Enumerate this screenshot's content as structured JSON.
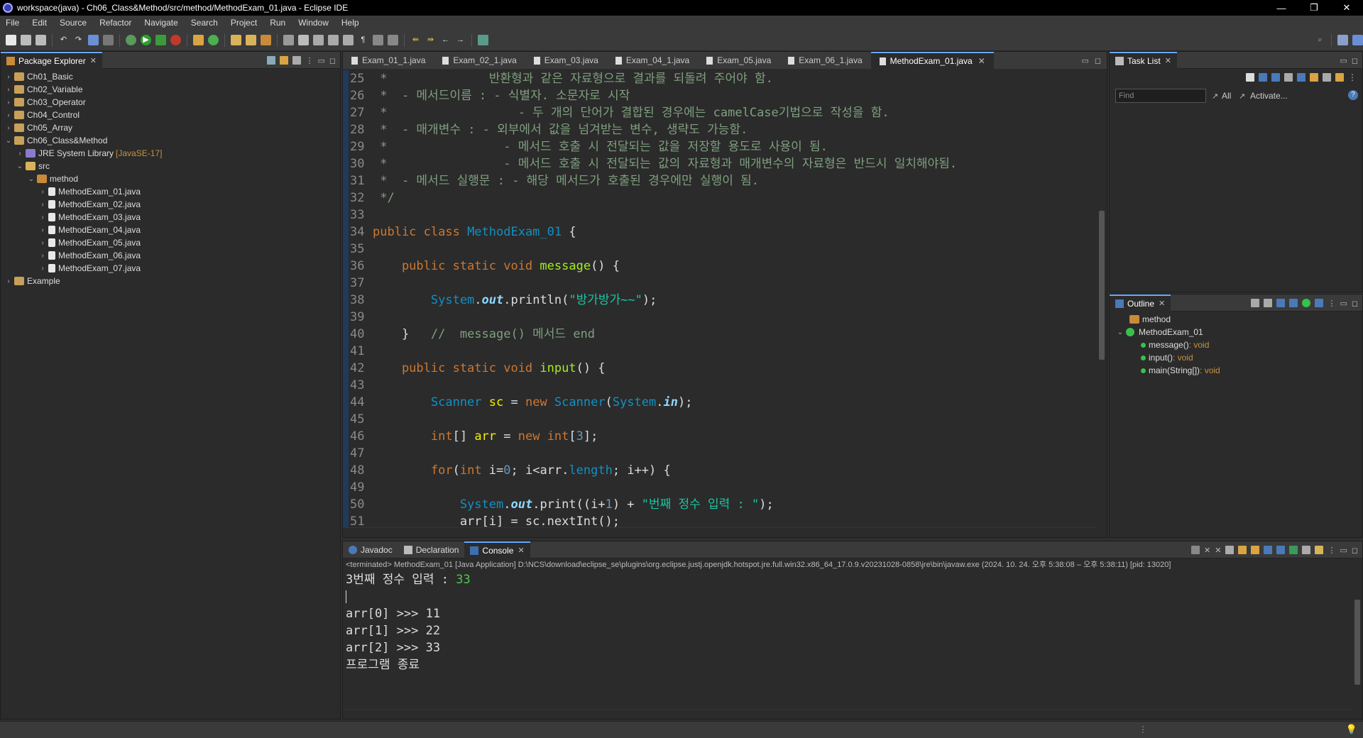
{
  "window": {
    "title": "workspace(java) - Ch06_Class&Method/src/method/MethodExam_01.java - Eclipse IDE",
    "minimize": "—",
    "maximize": "❐",
    "close": "✕"
  },
  "menu": [
    "File",
    "Edit",
    "Source",
    "Refactor",
    "Navigate",
    "Search",
    "Project",
    "Run",
    "Window",
    "Help"
  ],
  "package_explorer": {
    "title": "Package Explorer",
    "items": [
      {
        "label": "Ch01_Basic"
      },
      {
        "label": "Ch02_Variable"
      },
      {
        "label": "Ch03_Operator"
      },
      {
        "label": "Ch04_Control"
      },
      {
        "label": "Ch05_Array"
      },
      {
        "label": "Ch06_Class&Method"
      },
      {
        "label": "JRE System Library",
        "deco": "[JavaSE-17]"
      },
      {
        "label": "src"
      },
      {
        "label": "method"
      },
      {
        "label": "MethodExam_01.java"
      },
      {
        "label": "MethodExam_02.java"
      },
      {
        "label": "MethodExam_03.java"
      },
      {
        "label": "MethodExam_04.java"
      },
      {
        "label": "MethodExam_05.java"
      },
      {
        "label": "MethodExam_06.java"
      },
      {
        "label": "MethodExam_07.java"
      },
      {
        "label": "Example"
      }
    ]
  },
  "editor": {
    "tabs": [
      "Exam_01_1.java",
      "Exam_02_1.java",
      "Exam_03.java",
      "Exam_04_1.java",
      "Exam_05.java",
      "Exam_06_1.java",
      "MethodExam_01.java"
    ],
    "active_tab": "MethodExam_01.java",
    "line_numbers": [
      "25",
      "26",
      "27",
      "28",
      "29",
      "30",
      "31",
      "32",
      "33",
      "34",
      "35",
      "36",
      "37",
      "38",
      "39",
      "40",
      "41",
      "42",
      "43",
      "44",
      "45",
      "46",
      "47",
      "48",
      "49",
      "50",
      "51"
    ],
    "code": {
      "l25": " *              반환형과 같은 자료형으로 결과를 되돌려 주어야 함.",
      "l26": " *  - 메서드이름 : - 식별자. 소문자로 시작",
      "l27": " *                  - 두 개의 단어가 결합된 경우에는 camelCase기법으로 작성을 함.",
      "l28": " *  - 매개변수 : - 외부에서 값을 넘겨받는 변수, 생략도 가능함.",
      "l29": " *                - 메서드 호출 시 전달되는 값을 저장할 용도로 사용이 됨.",
      "l30": " *                - 메서드 호출 시 전달되는 값의 자료형과 매개변수의 자료형은 반드시 일치해야됨.",
      "l31": " *  - 메서드 실행문 : - 해당 메서드가 호출된 경우에만 실행이 됨.",
      "l32": " */",
      "l34_kw": "public class ",
      "l34_cls": "MethodExam_01",
      "l34_rest": " {",
      "l36_kw": "    public static void ",
      "l36_fn": "message",
      "l36_rest": "() {",
      "l38_cls": "        System",
      "l38_dot": ".",
      "l38_field": "out",
      "l38_call": ".println(",
      "l38_str": "\"방가방가~~\"",
      "l38_end": ");",
      "l40_a": "    }   ",
      "l40_cmt": "//  message() 메서드 end",
      "l42_kw": "    public static void ",
      "l42_fn": "input",
      "l42_rest": "() {",
      "l44_cls": "        Scanner",
      "l44_var": " sc",
      "l44_eq": " = ",
      "l44_new": "new ",
      "l44_cls2": "Scanner",
      "l44_p": "(",
      "l44_sys": "System",
      "l44_dot": ".",
      "l44_in": "in",
      "l44_end": ");",
      "l46_kw": "        int",
      "l46_a": "[] ",
      "l46_var": "arr",
      "l46_eq": " = ",
      "l46_new": "new int",
      "l46_b": "[",
      "l46_num": "3",
      "l46_end": "];",
      "l48_kw": "        for",
      "l48_p": "(",
      "l48_int": "int",
      "l48_i": " i",
      "l48_eq": "=",
      "l48_zero": "0",
      "l48_rest1": "; i<arr.",
      "l48_len": "length",
      "l48_rest2": "; i++) {",
      "l50_sys": "            System",
      "l50_dot": ".",
      "l50_out": "out",
      "l50_call": ".print((i+",
      "l50_one": "1",
      "l50_plus": ") + ",
      "l50_str": "\"번째 정수 입력 : \"",
      "l50_end": ");",
      "l51": "            arr[i] = sc.nextInt();"
    }
  },
  "console_view": {
    "tabs": [
      "Javadoc",
      "Declaration",
      "Console"
    ],
    "info": "<terminated> MethodExam_01 [Java Application] D:\\NCS\\download\\eclipse_se\\plugins\\org.eclipse.justj.openjdk.hotspot.jre.full.win32.x86_64_17.0.9.v20231028-0858\\jre\\bin\\javaw.exe  (2024. 10. 24. 오후 5:38:08 – 오후 5:38:11) [pid: 13020]",
    "prompt": "3번째 정수 입력 : ",
    "input": "33",
    "blank": "",
    "output": [
      "arr[0] >>> 11",
      "arr[1] >>> 22",
      "arr[2] >>> 33",
      "프로그램 종료"
    ]
  },
  "task_list": {
    "title": "Task List",
    "find_placeholder": "Find",
    "all": "All",
    "activate": "Activate..."
  },
  "outline": {
    "title": "Outline",
    "package": "method",
    "class": "MethodExam_01",
    "members": [
      {
        "name": "message()",
        "type": " : void"
      },
      {
        "name": "input()",
        "type": " : void"
      },
      {
        "name": "main(String[])",
        "type": " : void"
      }
    ]
  },
  "colors": {
    "accent": "#6aa6ff",
    "keyword": "#cc7832",
    "string": "#17c6a3",
    "comment": "#7f9f7f"
  }
}
